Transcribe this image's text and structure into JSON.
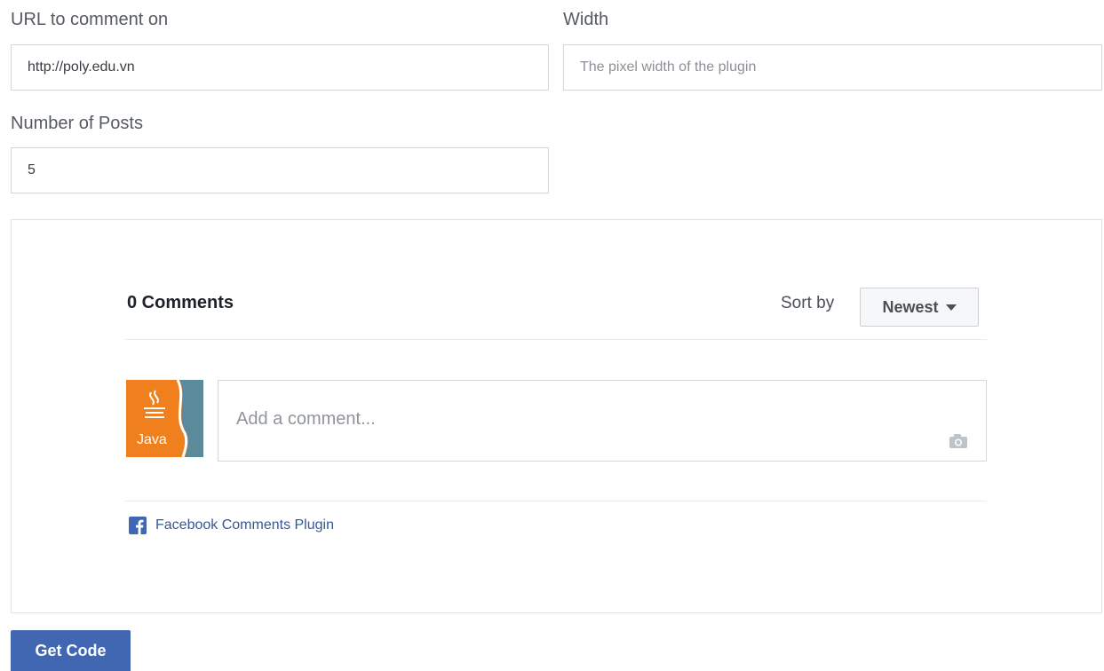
{
  "form": {
    "url_label": "URL to comment on",
    "url_value": "http://poly.edu.vn",
    "width_label": "Width",
    "width_placeholder": "The pixel width of the plugin",
    "posts_label": "Number of Posts",
    "posts_value": "5"
  },
  "preview": {
    "comment_count": "0 Comments",
    "sort_label": "Sort by",
    "sort_value": "Newest",
    "avatar_text": "Java",
    "comment_placeholder": "Add a comment...",
    "plugin_link": "Facebook Comments Plugin"
  },
  "actions": {
    "get_code": "Get Code"
  },
  "colors": {
    "facebook_blue": "#4267b2",
    "link_blue": "#365899",
    "java_orange": "#f07f1e"
  }
}
